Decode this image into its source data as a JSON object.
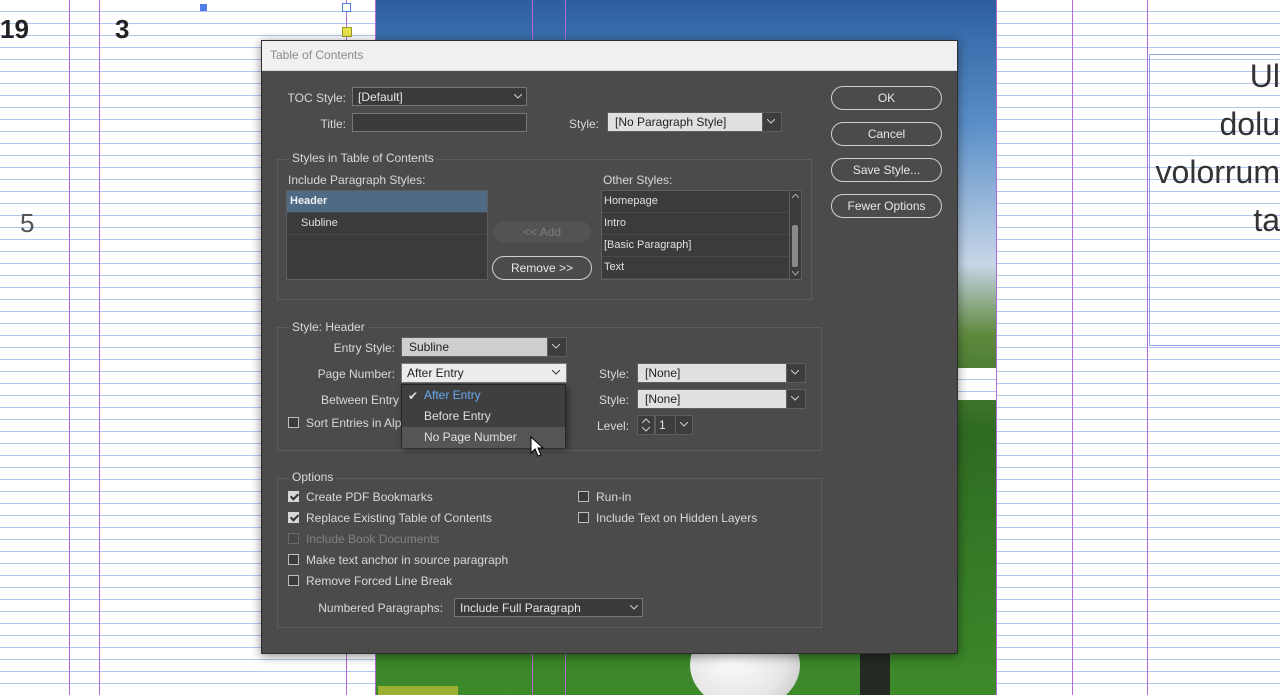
{
  "background": {
    "page_numbers": {
      "left": "19",
      "middle": "3",
      "side": "5"
    },
    "right_text_lines": [
      "Ul",
      "dolu",
      "volorrum",
      "ta"
    ]
  },
  "dialog": {
    "title": "Table of Contents",
    "toc_style_label": "TOC Style:",
    "toc_style_value": "[Default]",
    "title_label": "Title:",
    "title_value": "",
    "title_style_label": "Style:",
    "title_style_value": "[No Paragraph Style]",
    "buttons": {
      "ok": "OK",
      "cancel": "Cancel",
      "save_style": "Save Style...",
      "fewer_options": "Fewer Options",
      "add": "<< Add",
      "remove": "Remove >>"
    },
    "styles_section": {
      "title": "Styles in Table of Contents",
      "include_label": "Include Paragraph Styles:",
      "include_items": [
        "Header",
        "Subline"
      ],
      "other_label": "Other Styles:",
      "other_items": [
        "Homepage",
        "Intro",
        "[Basic Paragraph]",
        "Text"
      ]
    },
    "style_section": {
      "title": "Style: Header",
      "entry_style_label": "Entry Style:",
      "entry_style_value": "Subline",
      "page_number_label": "Page Number:",
      "page_number_value": "After Entry",
      "page_number_style_label": "Style:",
      "page_number_style_value": "[None]",
      "between_label": "Between Entry",
      "between_style_label": "Style:",
      "between_style_value": "[None]",
      "sort_label": "Sort Entries in Alp",
      "level_label": "Level:",
      "level_value": "1"
    },
    "page_number_menu": {
      "options": [
        "After Entry",
        "Before Entry",
        "No Page Number"
      ],
      "selected": "After Entry",
      "hovered": "No Page Number"
    },
    "options_section": {
      "title": "Options",
      "create_pdf_bookmarks": {
        "label": "Create PDF Bookmarks",
        "checked": true
      },
      "replace_existing": {
        "label": "Replace Existing Table of Contents",
        "checked": true
      },
      "include_book_docs": {
        "label": "Include Book Documents",
        "checked": false,
        "disabled": true
      },
      "make_text_anchor": {
        "label": "Make text anchor in source paragraph",
        "checked": false
      },
      "remove_forced_break": {
        "label": "Remove Forced Line Break",
        "checked": false
      },
      "run_in": {
        "label": "Run-in",
        "checked": false
      },
      "include_hidden_layers": {
        "label": "Include Text on Hidden Layers",
        "checked": false
      },
      "numbered_paragraphs_label": "Numbered Paragraphs:",
      "numbered_paragraphs_value": "Include Full Paragraph"
    }
  }
}
